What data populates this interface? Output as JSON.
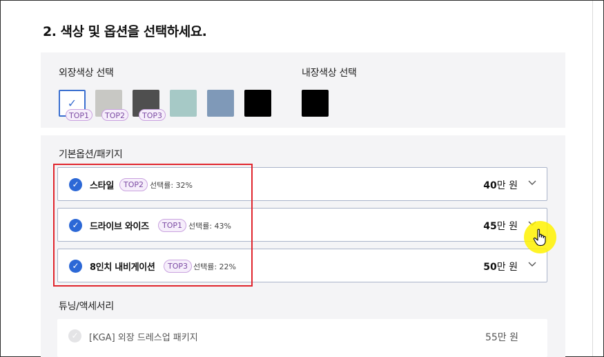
{
  "section_title": "2. 색상 및 옵션을 선택하세요.",
  "colors": {
    "exterior_label": "외장색상 선택",
    "interior_label": "내장색상 선택",
    "exterior_swatches": [
      {
        "color": "#ffffff",
        "selected": true,
        "badge": "TOP1",
        "check_icon": "check-icon"
      },
      {
        "color": "#c8c8c4",
        "selected": false,
        "badge": "TOP2"
      },
      {
        "color": "#4f4f4f",
        "selected": false,
        "badge": "TOP3"
      },
      {
        "color": "#a6c9c6",
        "selected": false,
        "badge": ""
      },
      {
        "color": "#7f99b8",
        "selected": false,
        "badge": ""
      },
      {
        "color": "#000000",
        "selected": false,
        "badge": ""
      }
    ],
    "interior_swatches": [
      {
        "color": "#000000",
        "selected": false
      }
    ]
  },
  "basic_options": {
    "label": "기본옵션/패키지",
    "items": [
      {
        "name": "스타일",
        "badge": "TOP2",
        "rate": "선택률: 32%",
        "price_amount": "40",
        "price_unit": "만 원",
        "checked": true
      },
      {
        "name": "드라이브 와이즈",
        "badge": "TOP1",
        "rate": "선택률: 43%",
        "price_amount": "45",
        "price_unit": "만 원",
        "checked": true
      },
      {
        "name": "8인치 내비게이션",
        "badge": "TOP3",
        "rate": "선택률: 22%",
        "price_amount": "50",
        "price_unit": "만 원",
        "checked": true
      }
    ]
  },
  "tuning": {
    "label": "튜닝/액세서리",
    "items": [
      {
        "name": "[KGA] 외장 드레스업 패키지",
        "price": "55만 원",
        "checked": false
      }
    ]
  },
  "accent_colors": {
    "check_blue": "#2c68d6",
    "badge_purple": "#7b4aa3",
    "highlight_red": "#e0242c",
    "cursor_yellow": "#fff200"
  }
}
